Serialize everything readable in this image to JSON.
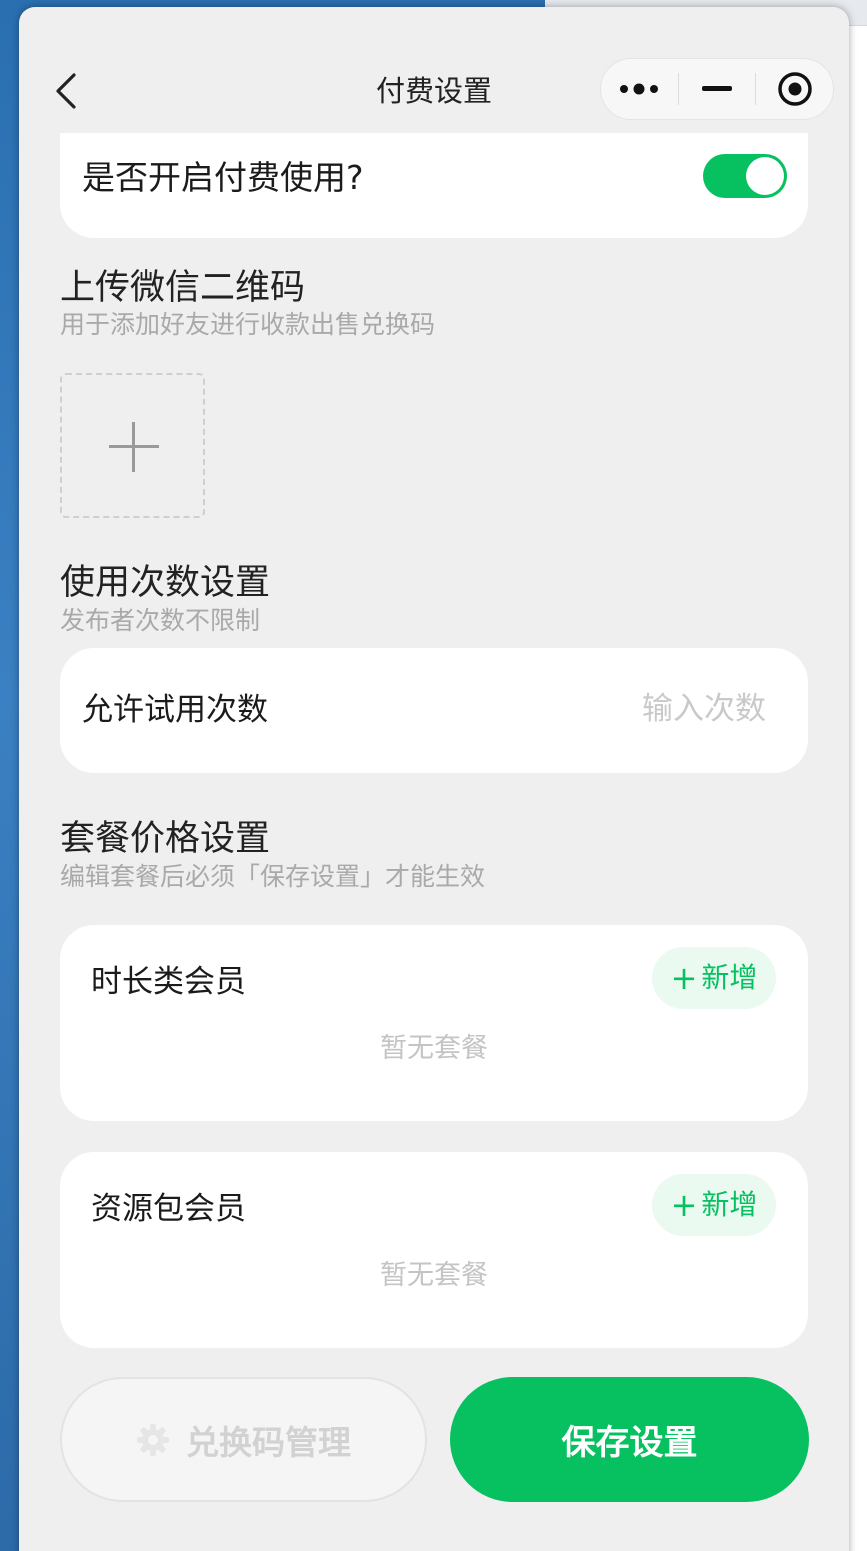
{
  "navbar": {
    "title": "付费设置",
    "back_icon": "chevron-left-icon",
    "capsule_icons": [
      "more-dots-icon",
      "minimize-icon",
      "close-target-icon"
    ]
  },
  "toggle": {
    "label": "是否开启付费使用?",
    "enabled": true
  },
  "upload": {
    "title": "上传微信二维码",
    "subtitle": "用于添加好友进行收款出售兑换码",
    "icon": "plus-icon"
  },
  "usage": {
    "title": "使用次数设置",
    "subtitle": "发布者次数不限制",
    "trial_label": "允许试用次数",
    "trial_placeholder": "输入次数",
    "trial_value": ""
  },
  "pricing": {
    "title": "套餐价格设置",
    "subtitle": "编辑套餐后必须「保存设置」才能生效",
    "plans": [
      {
        "title": "时长类会员",
        "add_label": "新增",
        "empty_text": "暂无套餐"
      },
      {
        "title": "资源包会员",
        "add_label": "新增",
        "empty_text": "暂无套餐"
      }
    ]
  },
  "actions": {
    "redeem_label": "兑换码管理",
    "redeem_icon": "gear-icon",
    "save_label": "保存设置"
  },
  "colors": {
    "accent": "#07c160",
    "accent_light": "#eafaf1",
    "page_bg": "#efefef"
  }
}
